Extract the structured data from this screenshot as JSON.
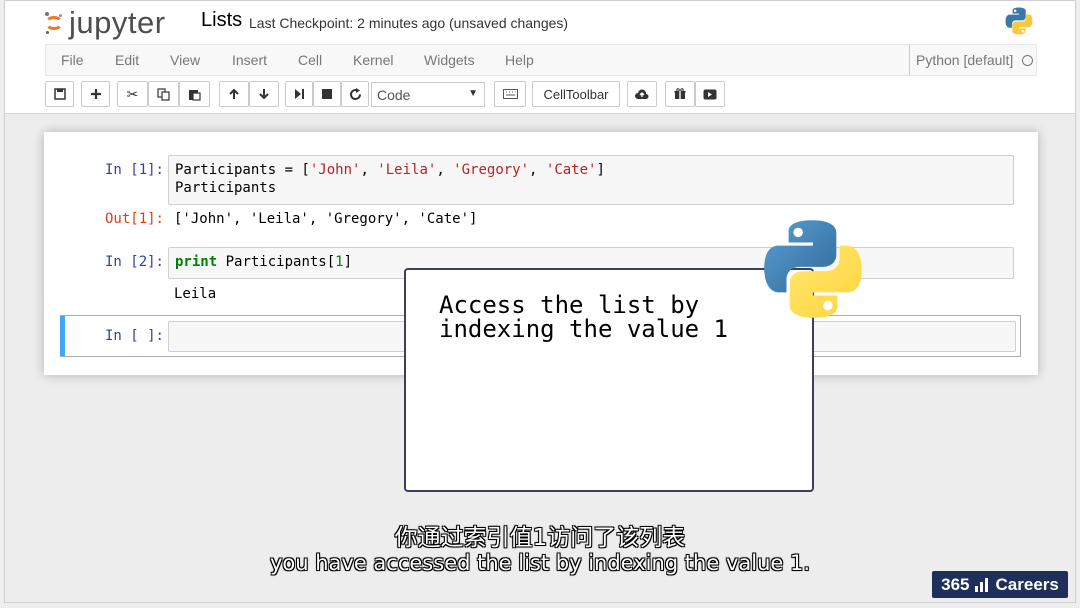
{
  "header": {
    "logo_text": "jupyter",
    "notebook_title": "Lists",
    "checkpoint": "Last Checkpoint: 2 minutes ago (unsaved changes)"
  },
  "menu": {
    "items": [
      "File",
      "Edit",
      "View",
      "Insert",
      "Cell",
      "Kernel",
      "Widgets",
      "Help"
    ],
    "kernel": "Python [default]"
  },
  "toolbar": {
    "buttons": [
      "save-icon",
      "add-icon",
      "cut-icon",
      "copy-icon",
      "paste-icon",
      "move-up-icon",
      "move-down-icon",
      "run-icon",
      "stop-icon",
      "restart-icon"
    ],
    "cell_type": "Code",
    "celltoolbar_label": "CellToolbar"
  },
  "cells": [
    {
      "prompt": "In [1]:",
      "code_line1_prefix": "Participants = [",
      "code_line1_items": [
        "'John'",
        "'Leila'",
        "'Gregory'",
        "'Cate'"
      ],
      "code_line2": "Participants",
      "out_prompt": "Out[1]:",
      "output": "['John', 'Leila', 'Gregory', 'Cate']"
    },
    {
      "prompt": "In [2]:",
      "code_kw": "print",
      "code_rest": " Participants[",
      "code_index": "1",
      "code_close": "]",
      "output": "Leila"
    },
    {
      "prompt": "In [ ]:"
    }
  ],
  "callout": {
    "text_line1": "Access the list by",
    "text_line2": "indexing the value 1"
  },
  "subtitles": {
    "chinese": "你通过索引值1访问了该列表",
    "english": "you have accessed the list by indexing the value 1."
  },
  "brand": {
    "number": "365",
    "name": "Careers"
  },
  "colors": {
    "accent_selected": "#42a5f5",
    "prompt_in": "#303f9f",
    "prompt_out": "#d84315",
    "string": "#ba2121",
    "brand_bg": "#1e2f59"
  }
}
